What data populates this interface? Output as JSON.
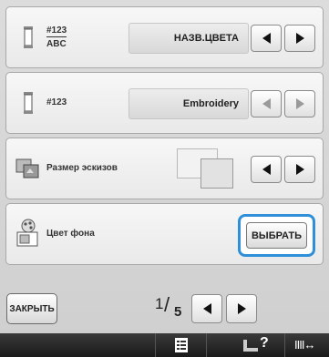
{
  "row_name_format": {
    "top_line": "#123",
    "bottom_line": "ABC",
    "value": "НАЗВ.ЦВЕТА"
  },
  "row_number_format": {
    "label": "#123",
    "value": "Embroidery"
  },
  "row_thumbnail_size": {
    "label": "Размер эскизов"
  },
  "row_background_color": {
    "label": "Цвет фона",
    "button_label": "ВЫБРАТЬ"
  },
  "footer": {
    "close_label": "ЗАКРЫТЬ",
    "page_current": "1",
    "page_total": "5"
  },
  "bottom_bar": {
    "help_label": "?",
    "relation_label": "IIII↔"
  },
  "colors": {
    "highlight": "#2f8fd8",
    "panel_bg": "#d6d6d6",
    "bottom_bar": "#222222"
  }
}
